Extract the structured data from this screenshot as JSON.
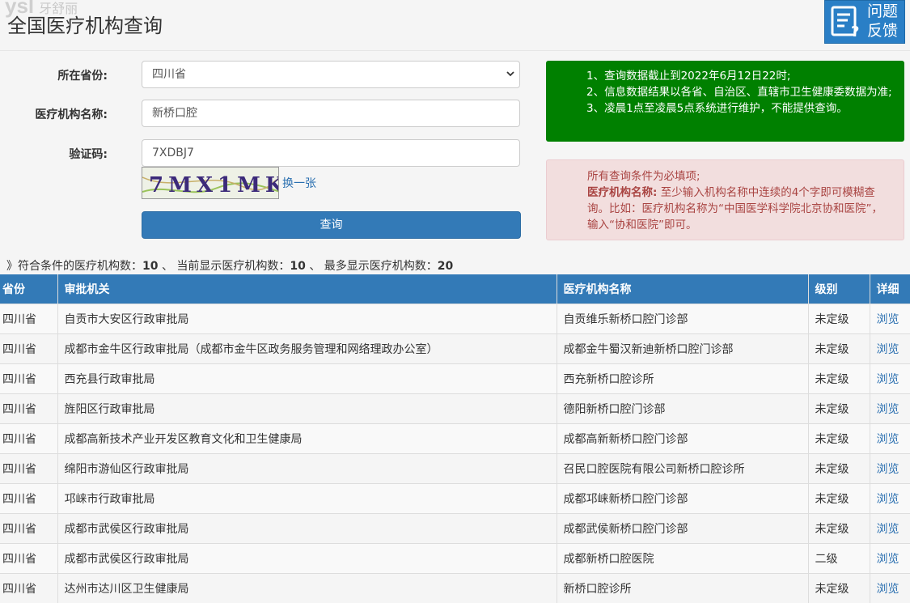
{
  "header": {
    "watermark_logo": "ysl",
    "watermark_text": "牙舒丽",
    "title": "全国医疗机构查询",
    "feedback_label": "问题反馈"
  },
  "form": {
    "province_label": "所在省份:",
    "province_value": "四川省",
    "institution_label": "医疗机构名称:",
    "institution_value": "新桥口腔",
    "captcha_label": "验证码:",
    "captcha_value": "7XDBJ7",
    "captcha_image_text": "7MX1MK",
    "refresh_label": "换一张",
    "submit_label": "查询"
  },
  "notices": {
    "green": [
      "1、查询数据截止到2022年6月12日22时;",
      "2、信息数据结果以各省、自治区、直辖市卫生健康委数据为准;",
      "3、凌晨1点至凌晨5点系统进行维护，不能提供查询。"
    ],
    "red_line1": "所有查询条件为必填项;",
    "red_label": "医疗机构名称:",
    "red_text": "至少输入机构名称中连续的4个字即可模糊查询。比如：医疗机构名称为“中国医学科学院北京协和医院”，输入“协和医院”即可。"
  },
  "summary": {
    "prefix": "》符合条件的医疗机构数：",
    "matched": "10",
    "sep1": "、 当前显示医疗机构数：",
    "shown": "10",
    "sep2": "、 最多显示医疗机构数：",
    "max": "20"
  },
  "table": {
    "headers": [
      "省份",
      "审批机关",
      "医疗机构名称",
      "级别",
      "详细"
    ],
    "rows": [
      [
        "四川省",
        "自贡市大安区行政审批局",
        "自贡维乐新桥口腔门诊部",
        "未定级",
        "浏览"
      ],
      [
        "四川省",
        "成都市金牛区行政审批局（成都市金牛区政务服务管理和网络理政办公室）",
        "成都金牛蜀汉新迪新桥口腔门诊部",
        "未定级",
        "浏览"
      ],
      [
        "四川省",
        "西充县行政审批局",
        "西充新桥口腔诊所",
        "未定级",
        "浏览"
      ],
      [
        "四川省",
        "旌阳区行政审批局",
        "德阳新桥口腔门诊部",
        "未定级",
        "浏览"
      ],
      [
        "四川省",
        "成都高新技术产业开发区教育文化和卫生健康局",
        "成都高新新桥口腔门诊部",
        "未定级",
        "浏览"
      ],
      [
        "四川省",
        "绵阳市游仙区行政审批局",
        "召民口腔医院有限公司新桥口腔诊所",
        "未定级",
        "浏览"
      ],
      [
        "四川省",
        "邛崃市行政审批局",
        "成都邛崃新桥口腔门诊部",
        "未定级",
        "浏览"
      ],
      [
        "四川省",
        "成都市武侯区行政审批局",
        "成都武侯新桥口腔门诊部",
        "未定级",
        "浏览"
      ],
      [
        "四川省",
        "成都市武侯区行政审批局",
        "成都新桥口腔医院",
        "二级",
        "浏览"
      ],
      [
        "四川省",
        "达州市达川区卫生健康局",
        "新桥口腔诊所",
        "未定级",
        "浏览"
      ]
    ]
  },
  "colors": {
    "primary": "#337ab7",
    "notice_green": "#008000",
    "notice_red_bg": "#f2dede",
    "notice_red_text": "#a94442",
    "link": "#2a6fb0"
  },
  "icons": {
    "feedback": "document-question-icon",
    "select_arrow": "chevron-down-icon"
  }
}
